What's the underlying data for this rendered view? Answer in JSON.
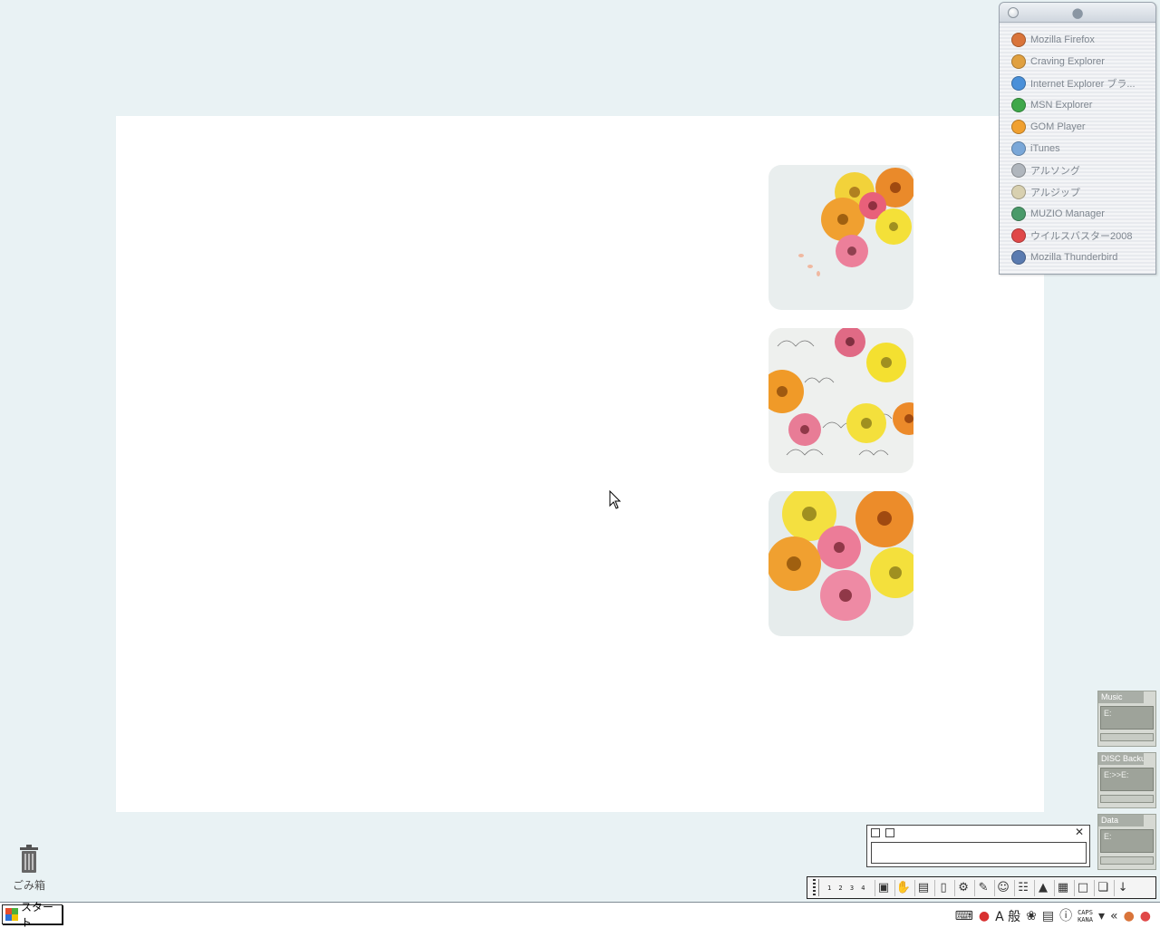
{
  "launcher": {
    "items": [
      {
        "label": "Mozilla Firefox",
        "icon": "firefox-icon",
        "color": "#d9743a"
      },
      {
        "label": "Craving Explorer",
        "icon": "craving-explorer-icon",
        "color": "#e0a040"
      },
      {
        "label": "Internet Explorer ブラ...",
        "icon": "internet-explorer-icon",
        "color": "#4a90d9"
      },
      {
        "label": "MSN Explorer",
        "icon": "msn-icon",
        "color": "#3fa84a"
      },
      {
        "label": "GOM Player",
        "icon": "gom-player-icon",
        "color": "#f0a030"
      },
      {
        "label": "iTunes",
        "icon": "itunes-icon",
        "color": "#7aa7d8"
      },
      {
        "label": "アルソング",
        "icon": "alsong-icon",
        "color": "#b0b6bd"
      },
      {
        "label": "アルジップ",
        "icon": "alzip-icon",
        "color": "#d8d0b0"
      },
      {
        "label": "MUZIO Manager",
        "icon": "muzio-manager-icon",
        "color": "#4a9a6a"
      },
      {
        "label": "ウイルスバスター2008",
        "icon": "virus-buster-icon",
        "color": "#e04848"
      },
      {
        "label": "Mozilla Thunderbird",
        "icon": "thunderbird-icon",
        "color": "#5a7bb0"
      }
    ]
  },
  "drives": [
    {
      "name": "Music",
      "path": "E:"
    },
    {
      "name": "DISC Backup",
      "path": "E:>>E:"
    },
    {
      "name": "Data",
      "path": "E:"
    }
  ],
  "quickbar": {
    "numbers": "1 2 3 4"
  },
  "desktop": {
    "trash_label": "ごみ箱"
  },
  "taskbar": {
    "start_label": "スタート",
    "ime_mode": "A 般",
    "caps": "CAPS",
    "kana": "KANA"
  }
}
